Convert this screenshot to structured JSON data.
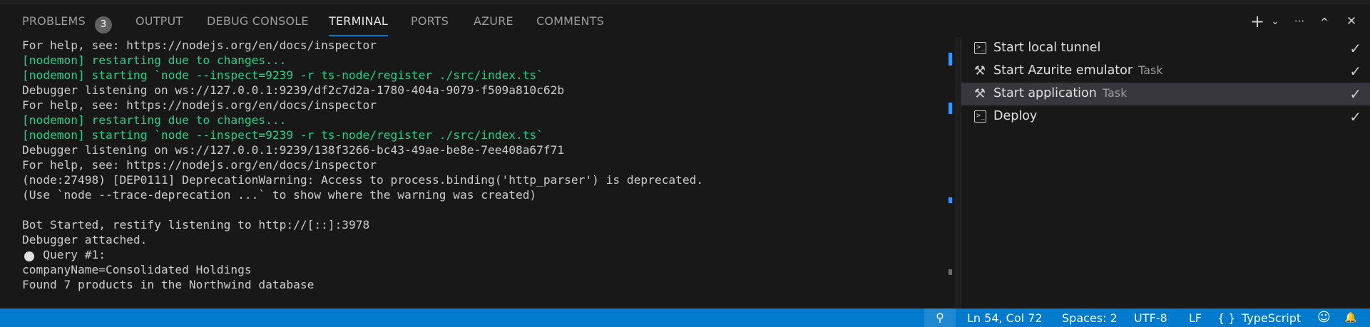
{
  "panel_tabs": [
    {
      "label": "PROBLEMS",
      "badge": "3"
    },
    {
      "label": "OUTPUT"
    },
    {
      "label": "DEBUG CONSOLE"
    },
    {
      "label": "TERMINAL",
      "active": true
    },
    {
      "label": "PORTS"
    },
    {
      "label": "AZURE"
    },
    {
      "label": "COMMENTS"
    }
  ],
  "toolbar_icons": {
    "add": "+",
    "dropdown": "⌄",
    "more": "···",
    "maximize": "⌃",
    "close": "✕"
  },
  "terminal_lines": [
    {
      "text": "For help, see: https://nodejs.org/en/docs/inspector",
      "color": "#cccccc"
    },
    {
      "text": "[nodemon] restarting due to changes...",
      "color": "#23d18b"
    },
    {
      "text": "[nodemon] starting `node --inspect=9239 -r ts-node/register ./src/index.ts`",
      "color": "#23d18b"
    },
    {
      "text": "Debugger listening on ws://127.0.0.1:9239/df2c7d2a-1780-404a-9079-f509a810c62b",
      "color": "#cccccc"
    },
    {
      "text": "For help, see: https://nodejs.org/en/docs/inspector",
      "color": "#cccccc"
    },
    {
      "text": "[nodemon] restarting due to changes...",
      "color": "#23d18b"
    },
    {
      "text": "[nodemon] starting `node --inspect=9239 -r ts-node/register ./src/index.ts`",
      "color": "#23d18b"
    },
    {
      "text": "Debugger listening on ws://127.0.0.1:9239/138f3266-bc43-49ae-be8e-7ee408a67f71",
      "color": "#cccccc"
    },
    {
      "text": "For help, see: https://nodejs.org/en/docs/inspector",
      "color": "#cccccc"
    },
    {
      "text": "(node:27498) [DEP0111] DeprecationWarning: Access to process.binding('http_parser') is deprecated.",
      "color": "#cccccc"
    },
    {
      "text": "(Use `node --trace-deprecation ...` to show where the warning was created)",
      "color": "#cccccc"
    },
    {
      "text": "",
      "color": "#cccccc"
    },
    {
      "text": "Bot Started, restify listening to http://[::]:3978",
      "color": "#cccccc"
    },
    {
      "text": "Debugger attached.",
      "color": "#cccccc"
    },
    {
      "text": "   Query #1:",
      "color": "#cccccc"
    },
    {
      "text": "companyName=Consolidated Holdings",
      "color": "#cccccc"
    },
    {
      "text": "Found 7 products in the Northwind database",
      "color": "#cccccc"
    }
  ],
  "tasks": [
    {
      "icon": "terminal-icon",
      "label": "Start local tunnel",
      "sub": "",
      "check": "✓"
    },
    {
      "icon": "tools-icon",
      "label": "Start Azurite emulator",
      "sub": "Task",
      "check": "✓"
    },
    {
      "icon": "tools-icon",
      "label": "Start application",
      "sub": "Task",
      "check": "✓",
      "selected": true
    },
    {
      "icon": "terminal-icon",
      "label": "Deploy",
      "sub": "",
      "check": "✓"
    }
  ],
  "status_bar": {
    "zoom_icon": "⚲",
    "position": "Ln 54, Col 72",
    "spaces": "Spaces: 2",
    "encoding": "UTF-8",
    "eol": "LF",
    "language_icon": "{ }",
    "language": "TypeScript",
    "copilot_icon": "☺",
    "bell_icon": "🔔"
  },
  "colors": {
    "accent": "#0078d4",
    "status_bar": "#007acc",
    "terminal_green": "#23d18b"
  }
}
